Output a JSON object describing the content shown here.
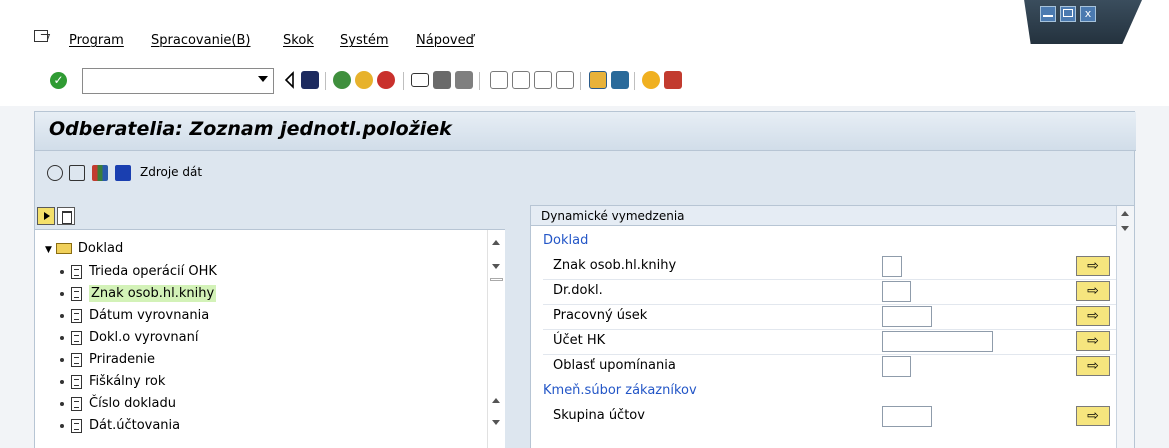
{
  "menu": {
    "items": [
      "Program",
      "Spracovanie(B)",
      "Skok",
      "Systém",
      "Nápoveď"
    ]
  },
  "toolbar": {
    "command_placeholder": "",
    "icons": [
      "check-icon",
      "dropdown-icon",
      "back-icon",
      "save-icon",
      "green-back-icon",
      "exit-icon",
      "cancel-icon",
      "print-icon",
      "find-icon",
      "find-next-icon",
      "first-page-icon",
      "prev-page-icon",
      "next-page-icon",
      "last-page-icon",
      "new-session-icon",
      "shortcut-icon",
      "help-icon",
      "layout-icon"
    ]
  },
  "page": {
    "title": "Odberatelia: Zoznam jednotl.položiek",
    "data_sources_label": "Zdroje dát"
  },
  "tree": {
    "root_label": "Doklad",
    "nodes": [
      {
        "label": "Trieda operácií OHK"
      },
      {
        "label": "Znak osob.hl.knihy",
        "highlighted": true
      },
      {
        "label": "Dátum vyrovnania"
      },
      {
        "label": "Dokl.o vyrovnaní"
      },
      {
        "label": "Priradenie"
      },
      {
        "label": "Fiškálny rok"
      },
      {
        "label": "Číslo dokladu"
      },
      {
        "label": "Dát.účtovania"
      }
    ]
  },
  "dynamic": {
    "header": "Dynamické vymedzenia",
    "section1": "Doklad",
    "fields": [
      {
        "label": "Znak osob.hl.knihy",
        "value": ""
      },
      {
        "label": "Dr.dokl.",
        "value": ""
      },
      {
        "label": "Pracovný úsek",
        "value": ""
      },
      {
        "label": "Účet HK",
        "value": ""
      },
      {
        "label": "Oblasť upomínania",
        "value": ""
      }
    ],
    "section2": "Kmeň.súbor zákazníkov",
    "fields2": [
      {
        "label": "Skupina účtov",
        "value": ""
      }
    ],
    "arrow_glyph": "⇨"
  },
  "colors": {
    "accent": "#2356c7",
    "panel_bg": "#dde6ef",
    "highlight": "#d3f2b8",
    "button_yellow": "#f6e57e"
  }
}
